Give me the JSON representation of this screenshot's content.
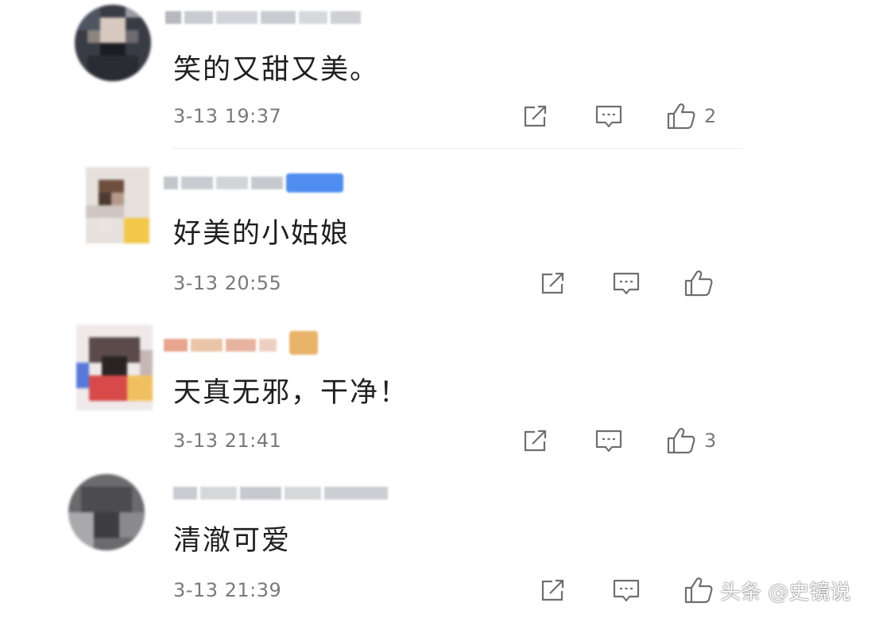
{
  "comments": [
    {
      "text": "笑的又甜又美。",
      "time": "3-13 19:37",
      "likes": "2"
    },
    {
      "text": "好美的小姑娘",
      "time": "3-13 20:55",
      "likes": ""
    },
    {
      "text": "天真无邪，干净！",
      "time": "3-13 21:41",
      "likes": "3"
    },
    {
      "text": "清澈可爱",
      "time": "3-13 21:39",
      "likes": ""
    }
  ],
  "icons": {
    "share": "share-icon",
    "reply": "comment-icon",
    "like": "thumbs-up-icon"
  },
  "colors": {
    "icon": "#6f6f6f",
    "time": "#7a7a7a",
    "text": "#1f1f1f"
  },
  "watermark": {
    "text": "头条 @史镜说"
  }
}
